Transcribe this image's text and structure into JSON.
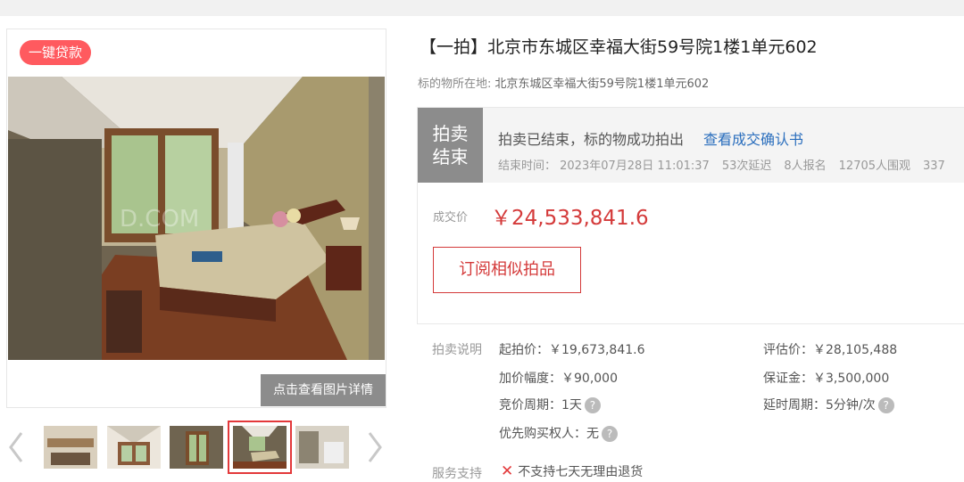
{
  "gallery": {
    "badge": "一键贷款",
    "detail_button": "点击查看图片详情",
    "watermark": "D.COM",
    "thumbnails_count": 5,
    "selected_thumbnail": 4,
    "icons": {
      "prev": "chevron-left-icon",
      "next": "chevron-right-icon"
    }
  },
  "listing": {
    "title": "【一拍】北京市东城区幸福大街59号院1楼1单元602",
    "location_label": "标的物所在地:",
    "location_value": "北京东城区幸福大街59号院1楼1单元602"
  },
  "status": {
    "block_line1": "拍卖",
    "block_line2": "结束",
    "message": "拍卖已结束，标的物成功拍出",
    "link": "查看成交确认书",
    "end_time": "结束时间： 2023年07月28日 11:01:37",
    "delays": "53次延迟",
    "signups": "8人报名",
    "watchers": "12705人围观",
    "extra": "337"
  },
  "deal": {
    "label": "成交价",
    "price": "￥24,533,841.6",
    "subscribe_button": "订阅相似拍品"
  },
  "auction_info": {
    "label": "拍卖说明",
    "start_price": "起拍价：￥19,673,841.6",
    "appraisal": "评估价：￥28,105,488",
    "increment": "加价幅度：￥90,000",
    "deposit": "保证金：￥3,500,000",
    "period": "竞价周期：1天",
    "extension": "延时周期：5分钟/次",
    "priority": "优先购买权人：无"
  },
  "service": {
    "label": "服务支持",
    "item": "不支持七天无理由退货"
  },
  "colors": {
    "accent": "#d43a3a",
    "link": "#2a6ebd",
    "badge": "#ff5a5f",
    "gray": "#8c8c8c"
  }
}
